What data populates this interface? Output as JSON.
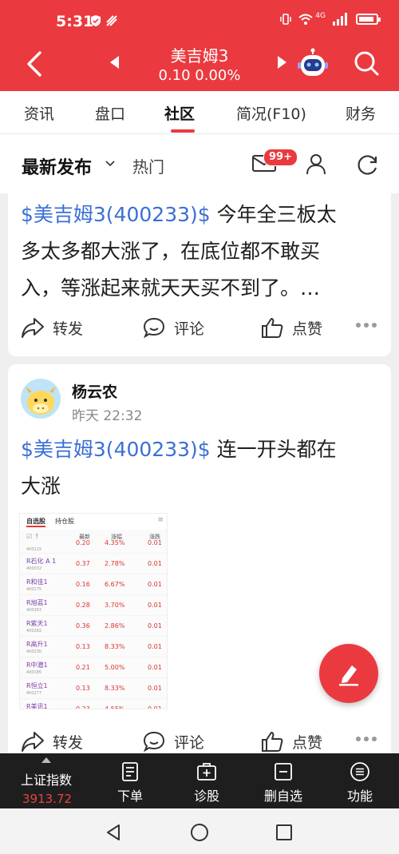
{
  "status_bar": {
    "time": "5:31",
    "network": "4G"
  },
  "header": {
    "stock_name": "美吉姆3",
    "quote": "0.10 0.00%"
  },
  "tabs": [
    "资讯",
    "盘口",
    "社区",
    "简况(F10)",
    "财务"
  ],
  "active_tab": "社区",
  "subbar": {
    "latest": "最新发布",
    "hot": "热门",
    "message_badge": "99+"
  },
  "posts": [
    {
      "stock_tag": "$美吉姆3(400233)$",
      "text_line1": " 今年全三板太",
      "text_line2": "多太多都大涨了，在底位都不敢买",
      "text_line3": "入，等涨起来就天天买不到了。…",
      "share_label": "转发",
      "comment_label": "评论",
      "like_label": "点赞"
    },
    {
      "author": "杨云农",
      "time": "昨天 22:32",
      "stock_tag": "$美吉姆3(400233)$",
      "text_line1": " 连一开头都在",
      "text_line2": "大涨",
      "share_label": "转发",
      "comment_label": "评论",
      "like_label": "点赞"
    }
  ],
  "embedded_screenshot": {
    "tabs": [
      "自选股",
      "持仓股"
    ],
    "headers": [
      "最新",
      "涨幅",
      "涨跌"
    ],
    "partial_top": {
      "price": "0.20",
      "pct": "4.35%",
      "chg": "0.01",
      "code": "400115"
    },
    "rows": [
      {
        "name": "R石化 A 1",
        "code": "400032",
        "price": "0.37",
        "pct": "2.78%",
        "chg": "0.01"
      },
      {
        "name": "R和佳1",
        "code": "400175",
        "price": "0.16",
        "pct": "6.67%",
        "chg": "0.01"
      },
      {
        "name": "R旭蓝1",
        "code": "400263",
        "price": "0.28",
        "pct": "3.70%",
        "chg": "0.01"
      },
      {
        "name": "R紫天1",
        "code": "400282",
        "price": "0.36",
        "pct": "2.86%",
        "chg": "0.01"
      },
      {
        "name": "R高升1",
        "code": "400230",
        "price": "0.13",
        "pct": "8.33%",
        "chg": "0.01"
      },
      {
        "name": "R中潜1",
        "code": "400185",
        "price": "0.21",
        "pct": "5.00%",
        "chg": "0.01"
      },
      {
        "name": "R恒立1",
        "code": "400277",
        "price": "0.13",
        "pct": "8.33%",
        "chg": "0.01"
      },
      {
        "name": "R美讯1",
        "code": "",
        "price": "0.23",
        "pct": "4.55%",
        "chg": "0.01"
      }
    ]
  },
  "bottom_bar": {
    "index_name": "上证指数",
    "index_value": "3913.72",
    "tools": [
      "下单",
      "诊股",
      "删自选",
      "功能"
    ]
  },
  "colors": {
    "brand_red": "#ea3a3f",
    "link_blue": "#3b6fd4"
  }
}
